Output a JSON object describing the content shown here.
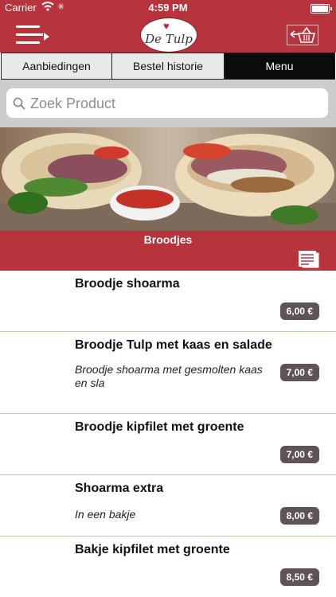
{
  "status_bar": {
    "carrier": "Carrier",
    "time": "4:59 PM"
  },
  "navbar": {
    "logo_text": "De Tulp"
  },
  "tabs": [
    {
      "label": "Aanbiedingen"
    },
    {
      "label": "Bestel historie"
    },
    {
      "label": "Menu",
      "active": true
    }
  ],
  "search": {
    "placeholder": "Zoek Product"
  },
  "category": {
    "title": "Broodjes"
  },
  "products": [
    {
      "name": "Broodje shoarma",
      "description": "",
      "price": "6,00 €"
    },
    {
      "name": "Broodje Tulp met kaas en salade",
      "description": "Broodje shoarma met gesmolten kaas en sla",
      "price": "7,00 €"
    },
    {
      "name": "Broodje kipfilet met groente",
      "description": "",
      "price": "7,00 €"
    },
    {
      "name": "Shoarma extra",
      "description": "In een bakje",
      "price": "8,00 €"
    },
    {
      "name": "Bakje kipfilet met groente",
      "description": "",
      "price": "8,50 €"
    }
  ],
  "colors": {
    "brand_red": "#b8343c",
    "price_badge": "#5e5358",
    "tab_active": "#0b0b0b"
  },
  "icons": {
    "menu": "hamburger-arrow-icon",
    "cart": "basket-icon",
    "search": "magnifier-icon",
    "category": "menu-card-icon"
  }
}
